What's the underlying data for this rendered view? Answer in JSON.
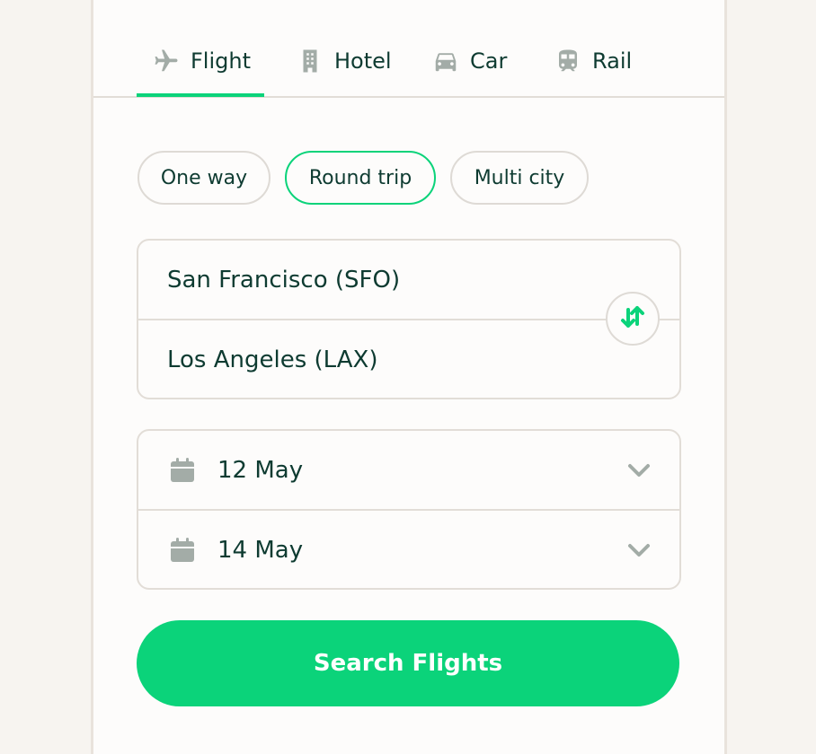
{
  "tabs": [
    {
      "label": "Flight",
      "icon": "plane-icon",
      "active": true
    },
    {
      "label": "Hotel",
      "icon": "building-icon",
      "active": false
    },
    {
      "label": "Car",
      "icon": "car-icon",
      "active": false
    },
    {
      "label": "Rail",
      "icon": "train-icon",
      "active": false
    }
  ],
  "trip_types": [
    {
      "label": "One way",
      "selected": false
    },
    {
      "label": "Round trip",
      "selected": true
    },
    {
      "label": "Multi city",
      "selected": false
    }
  ],
  "route": {
    "origin": "San Francisco (SFO)",
    "destination": "Los Angeles (LAX)",
    "swap_icon": "swap-arrows-icon"
  },
  "dates": {
    "departure": "12 May",
    "return": "14 May",
    "icon": "calendar-icon",
    "dropdown_icon": "chevron-down-icon"
  },
  "search": {
    "label": "Search Flights"
  },
  "colors": {
    "accent": "#0bd37a",
    "text": "#0e3b31",
    "icon_gray": "#a3aca7",
    "border": "#e2ddd7",
    "background": "#f7f4f0"
  }
}
